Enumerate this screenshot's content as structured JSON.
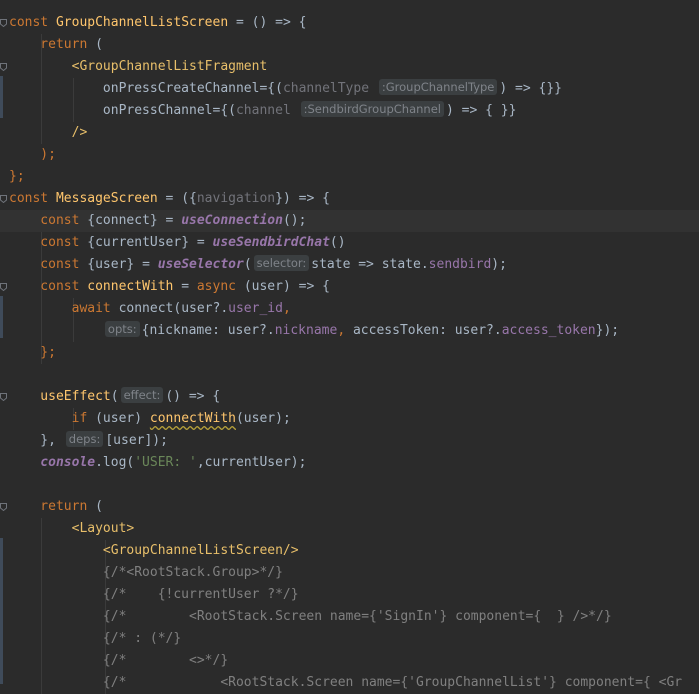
{
  "colors": {
    "background": "#2b2b2b",
    "keyword": "#cc7832",
    "identifier": "#a9b7c6",
    "function_italic": "#9876aa",
    "property": "#9876aa",
    "jsx_tag": "#e8bf6a",
    "string": "#6a8759",
    "comment": "#808080",
    "definition": "#ffc66d",
    "param_faded": "#72737a"
  },
  "lines": [
    [
      {
        "t": "const ",
        "c": "kw"
      },
      {
        "t": "GroupChannelListScreen",
        "c": "def"
      },
      {
        "t": " = () => {",
        "c": "id"
      }
    ],
    [
      {
        "t": "    return ",
        "c": "kw"
      },
      {
        "t": "(",
        "c": "id"
      }
    ],
    [
      {
        "t": "        ",
        "c": "id"
      },
      {
        "t": "<GroupChannelListFragment",
        "c": "tag"
      }
    ],
    [
      {
        "t": "            onPressCreateChannel",
        "c": "attr"
      },
      {
        "t": "={(",
        "c": "id"
      },
      {
        "t": "channelType",
        "c": "faded"
      },
      {
        "t": " ",
        "c": "id"
      },
      {
        "h": ":GroupChannelType"
      },
      {
        "t": ") => {}}",
        "c": "id"
      }
    ],
    [
      {
        "t": "            onPressChannel",
        "c": "attr"
      },
      {
        "t": "={(",
        "c": "id"
      },
      {
        "t": "channel",
        "c": "faded"
      },
      {
        "t": " ",
        "c": "id"
      },
      {
        "h": ":SendbirdGroupChannel"
      },
      {
        "t": ") => { }}",
        "c": "id"
      }
    ],
    [
      {
        "t": "        />",
        "c": "tag"
      }
    ],
    [
      {
        "t": "    );",
        "c": "kw"
      }
    ],
    [
      {
        "t": "};",
        "c": "kw"
      }
    ],
    [
      {
        "t": "const ",
        "c": "kw"
      },
      {
        "t": "MessageScreen",
        "c": "def"
      },
      {
        "t": " = ({",
        "c": "id"
      },
      {
        "t": "navigation",
        "c": "faded"
      },
      {
        "t": "}) => {",
        "c": "id"
      }
    ],
    [
      {
        "t": "    const ",
        "c": "kw"
      },
      {
        "t": "{connect} = ",
        "c": "id"
      },
      {
        "t": "useConnection",
        "c": "fn"
      },
      {
        "t": "();",
        "c": "id"
      }
    ],
    [
      {
        "t": "    const ",
        "c": "kw"
      },
      {
        "t": "{currentUser} = ",
        "c": "id"
      },
      {
        "t": "useSendbirdChat",
        "c": "fn"
      },
      {
        "t": "()",
        "c": "id"
      }
    ],
    [
      {
        "t": "    const ",
        "c": "kw"
      },
      {
        "t": "{user} = ",
        "c": "id"
      },
      {
        "t": "useSelector",
        "c": "fn"
      },
      {
        "t": "(",
        "c": "id"
      },
      {
        "h": "selector:"
      },
      {
        "t": "state => state.",
        "c": "id"
      },
      {
        "t": "sendbird",
        "c": "prop"
      },
      {
        "t": ");",
        "c": "id"
      }
    ],
    [
      {
        "t": "    const ",
        "c": "kw"
      },
      {
        "t": "connectWith",
        "c": "def"
      },
      {
        "t": " = ",
        "c": "id"
      },
      {
        "t": "async ",
        "c": "kw"
      },
      {
        "t": "(user) => {",
        "c": "id"
      }
    ],
    [
      {
        "t": "        await ",
        "c": "kw"
      },
      {
        "t": "connect(user?.",
        "c": "id"
      },
      {
        "t": "user_id",
        "c": "prop"
      },
      {
        "t": ",",
        "c": "kw"
      }
    ],
    [
      {
        "t": "            ",
        "c": "id"
      },
      {
        "h": "opts:"
      },
      {
        "t": "{nickname: user?.",
        "c": "id"
      },
      {
        "t": "nickname",
        "c": "prop"
      },
      {
        "t": ", ",
        "c": "kw"
      },
      {
        "t": "accessToken: user?.",
        "c": "id"
      },
      {
        "t": "access_token",
        "c": "prop"
      },
      {
        "t": "});",
        "c": "id"
      }
    ],
    [
      {
        "t": "    };",
        "c": "kw"
      }
    ],
    [],
    [
      {
        "t": "    useEffect",
        "c": "ydef"
      },
      {
        "t": "(",
        "c": "id"
      },
      {
        "h": "effect:"
      },
      {
        "t": "() => {",
        "c": "id"
      }
    ],
    [
      {
        "t": "        if ",
        "c": "kw"
      },
      {
        "t": "(user) ",
        "c": "id"
      },
      {
        "t": "connectWith",
        "c": "ydef_sq"
      },
      {
        "t": "(user);",
        "c": "id"
      }
    ],
    [
      {
        "t": "    }, ",
        "c": "id"
      },
      {
        "h": "deps:"
      },
      {
        "t": "[user]);",
        "c": "id"
      }
    ],
    [
      {
        "t": "    console",
        "c": "fn"
      },
      {
        "t": ".log(",
        "c": "id"
      },
      {
        "t": "'USER: '",
        "c": "str"
      },
      {
        "t": ",currentUser);",
        "c": "id"
      }
    ],
    [],
    [
      {
        "t": "    return ",
        "c": "kw"
      },
      {
        "t": "(",
        "c": "id"
      }
    ],
    [
      {
        "t": "        ",
        "c": "id"
      },
      {
        "t": "<Layout>",
        "c": "tag"
      }
    ],
    [
      {
        "t": "            ",
        "c": "id"
      },
      {
        "t": "<GroupChannelListScreen/>",
        "c": "tag"
      }
    ],
    [
      {
        "t": "            {/*<RootStack.Group>*/}",
        "c": "cm"
      }
    ],
    [
      {
        "t": "            {/*    {!currentUser ?*/}",
        "c": "cm"
      }
    ],
    [
      {
        "t": "            {/*        <RootStack.Screen name={'SignIn'} component={  } />*/}",
        "c": "cm"
      }
    ],
    [
      {
        "t": "            {/* : (*/}",
        "c": "cm"
      }
    ],
    [
      {
        "t": "            {/*        <>*/}",
        "c": "cm"
      }
    ],
    [
      {
        "t": "            {/*            <RootStack.Screen name={'GroupChannelList'} component={ <Gr",
        "c": "cm"
      }
    ]
  ]
}
